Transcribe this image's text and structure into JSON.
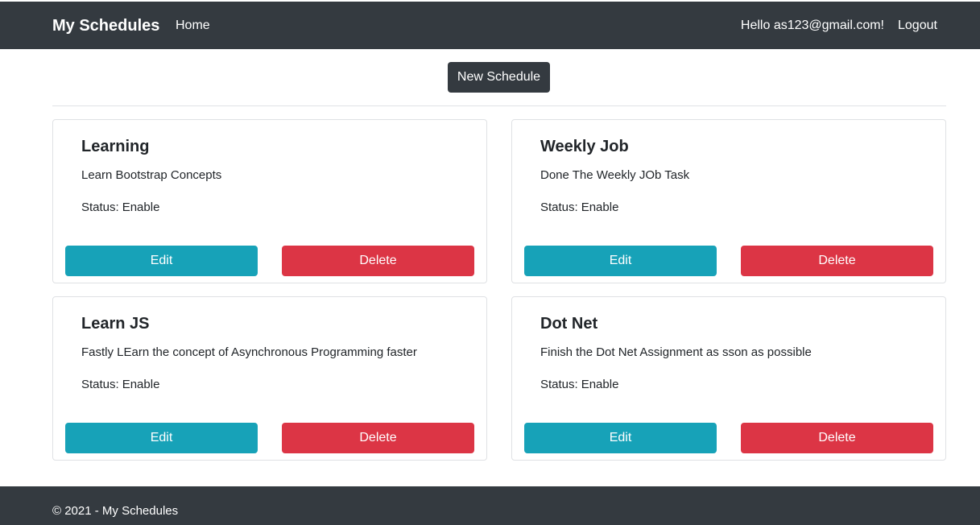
{
  "navbar": {
    "brand": "My Schedules",
    "links": [
      {
        "label": "Home"
      }
    ],
    "greeting": "Hello as123@gmail.com!",
    "logout_label": "Logout"
  },
  "main": {
    "new_schedule_label": "New Schedule",
    "schedules": [
      {
        "title": "Learning",
        "description": "Learn Bootstrap Concepts",
        "status_label": "Status:",
        "status": "Enable",
        "edit_label": "Edit",
        "delete_label": "Delete"
      },
      {
        "title": "Weekly Job",
        "description": "Done The Weekly JOb Task",
        "status_label": "Status:",
        "status": "Enable",
        "edit_label": "Edit",
        "delete_label": "Delete"
      },
      {
        "title": "Learn JS",
        "description": "Fastly LEarn the concept of Asynchronous Programming faster",
        "status_label": "Status:",
        "status": "Enable",
        "edit_label": "Edit",
        "delete_label": "Delete"
      },
      {
        "title": "Dot Net",
        "description": "Finish the Dot Net Assignment as sson as possible",
        "status_label": "Status:",
        "status": "Enable",
        "edit_label": "Edit",
        "delete_label": "Delete"
      }
    ]
  },
  "footer": {
    "text": "© 2021 - My Schedules"
  },
  "colors": {
    "navbar_bg": "#343a40",
    "edit_button": "#17a2b8",
    "delete_button": "#dc3545",
    "card_border": "#dfe1e4"
  }
}
